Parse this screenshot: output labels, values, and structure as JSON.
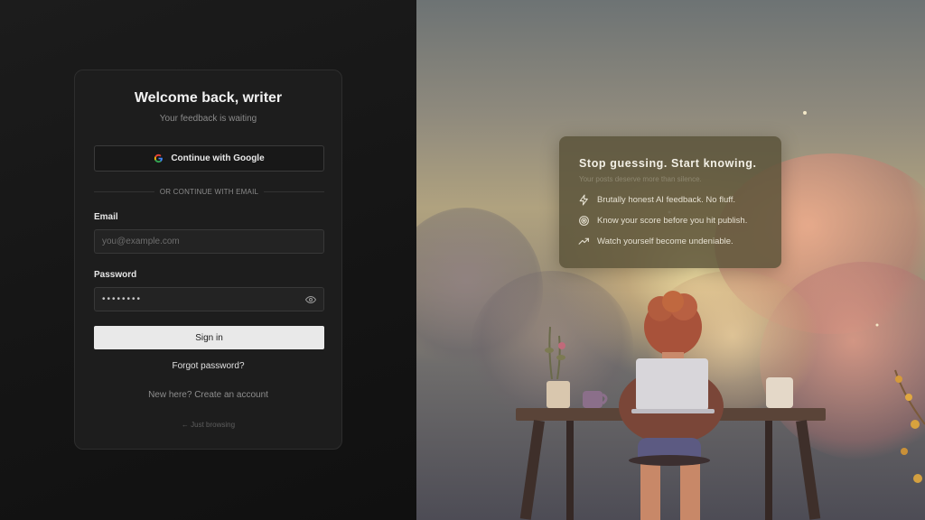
{
  "login": {
    "title": "Welcome back, writer",
    "subtitle": "Your feedback is waiting",
    "google_label": "Continue with Google",
    "divider_text": "OR CONTINUE WITH EMAIL",
    "email_label": "Email",
    "email_placeholder": "you@example.com",
    "password_label": "Password",
    "password_value": "••••••••",
    "signin_label": "Sign in",
    "forgot_label": "Forgot password?",
    "create_label": "New here? Create an account",
    "browse_label": "← Just browsing"
  },
  "promo": {
    "title": "Stop guessing. Start knowing.",
    "subtitle": "Your posts deserve more than silence.",
    "items": [
      {
        "icon": "lightning-icon",
        "text": "Brutally honest AI feedback. No fluff."
      },
      {
        "icon": "target-icon",
        "text": "Know your score before you hit publish."
      },
      {
        "icon": "trending-up-icon",
        "text": "Watch yourself become undeniable."
      }
    ]
  },
  "colors": {
    "accent_google_blue": "#4285F4",
    "signin_bg": "#e9e9e9",
    "card_bg": "#1d1d1d"
  }
}
